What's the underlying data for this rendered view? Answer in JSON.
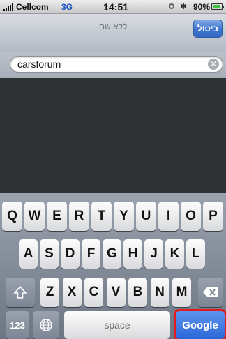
{
  "status_bar": {
    "carrier": "Cellcom",
    "network": "3G",
    "time": "14:51",
    "battery_percent": "90%",
    "battery_level": 0.9
  },
  "nav": {
    "title": "ללא שם",
    "cancel_label": "ביטול"
  },
  "search": {
    "value": "carsforum"
  },
  "keyboard": {
    "row1": [
      "Q",
      "W",
      "E",
      "R",
      "T",
      "Y",
      "U",
      "I",
      "O",
      "P"
    ],
    "row2": [
      "A",
      "S",
      "D",
      "F",
      "G",
      "H",
      "J",
      "K",
      "L"
    ],
    "row3": [
      "Z",
      "X",
      "C",
      "V",
      "B",
      "N",
      "M"
    ],
    "numbers_label": "123",
    "space_label": "space",
    "go_label": "Google"
  },
  "icons": {
    "shift": "shift-icon",
    "backspace": "backspace-icon",
    "globe": "globe-icon",
    "clear": "clear-icon",
    "bluetooth": "bluetooth-icon",
    "lock": "orientation-lock-icon"
  },
  "colors": {
    "accent_blue": "#3f76cf",
    "google_key": "#2c67d8",
    "highlight_border": "#e01b1b"
  }
}
